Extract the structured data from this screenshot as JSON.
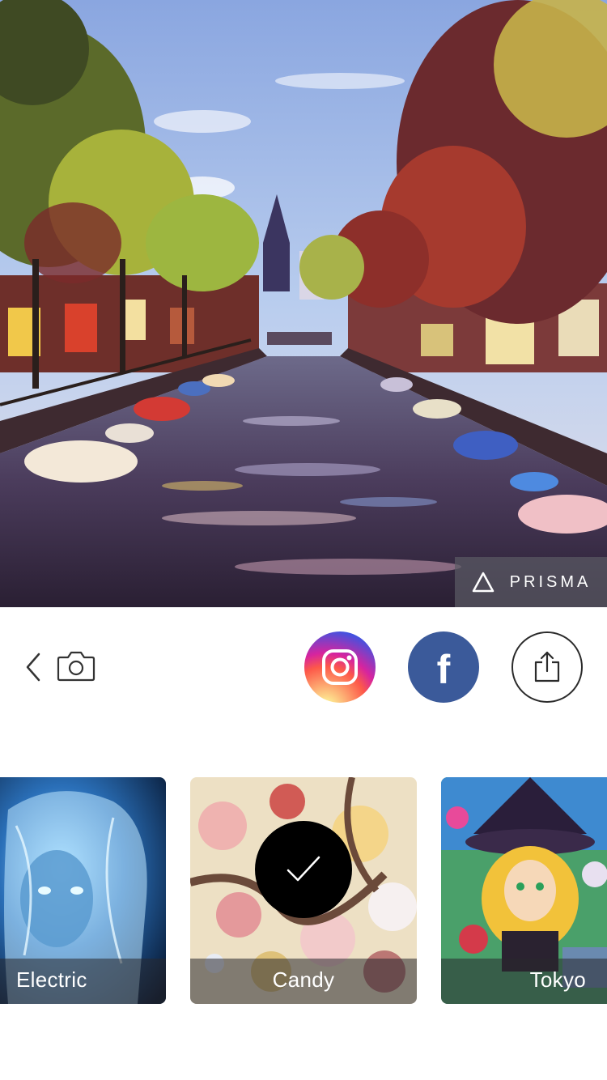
{
  "photo": {
    "description_icon": "stylized-canal-photo",
    "watermark": {
      "icon": "prisma-triangle-icon",
      "text": "PRISMA"
    }
  },
  "toolbar": {
    "back_icon": "chevron-left-icon",
    "camera_icon": "camera-icon",
    "share_targets": [
      {
        "name": "instagram",
        "icon": "instagram-icon",
        "color": "#d6249f"
      },
      {
        "name": "facebook",
        "icon": "facebook-icon",
        "letter": "f",
        "color": "#3b5a9a"
      },
      {
        "name": "more",
        "icon": "share-icon"
      }
    ]
  },
  "filters": {
    "items": [
      {
        "label": "Electric",
        "selected": false
      },
      {
        "label": "Candy",
        "selected": true
      },
      {
        "label": "Tokyo",
        "selected": false
      }
    ],
    "selected_icon": "checkmark-icon"
  }
}
